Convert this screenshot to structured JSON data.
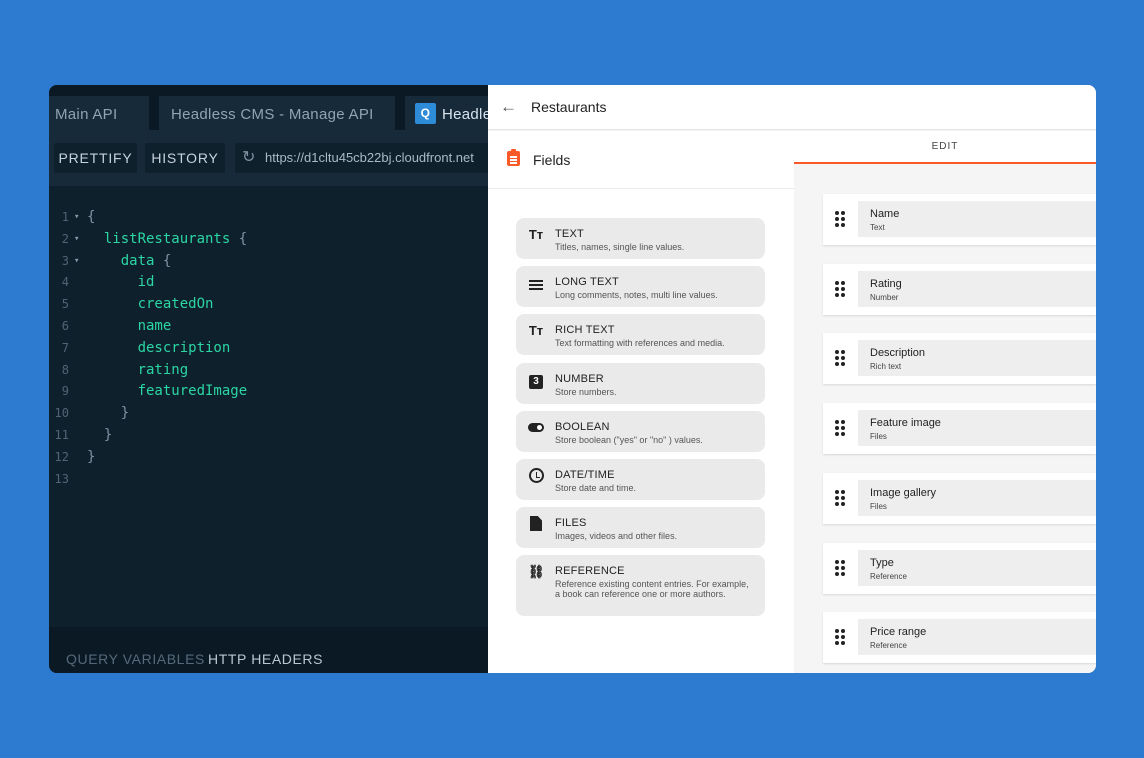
{
  "playground": {
    "tabs": [
      {
        "label": "Main API"
      },
      {
        "label": "Headless CMS - Manage API"
      },
      {
        "badge": "Q",
        "label": "Headless CMS"
      }
    ],
    "toolbar": {
      "prettify": "PRETTIFY",
      "history": "HISTORY",
      "url": "https://d1cltu45cb22bj.cloudfront.net"
    },
    "code": [
      {
        "n": "1",
        "fold": "▾",
        "text": "{",
        "field": ""
      },
      {
        "n": "2",
        "fold": "▾",
        "text": "  ",
        "field": "listRestaurants",
        "after": " {"
      },
      {
        "n": "3",
        "fold": "▾",
        "text": "    ",
        "field": "data",
        "after": " {"
      },
      {
        "n": "4",
        "fold": "",
        "text": "      ",
        "field": "id"
      },
      {
        "n": "5",
        "fold": "",
        "text": "      ",
        "field": "createdOn"
      },
      {
        "n": "6",
        "fold": "",
        "text": "      ",
        "field": "name"
      },
      {
        "n": "7",
        "fold": "",
        "text": "      ",
        "field": "description"
      },
      {
        "n": "8",
        "fold": "",
        "text": "      ",
        "field": "rating"
      },
      {
        "n": "9",
        "fold": "",
        "text": "      ",
        "field": "featuredImage"
      },
      {
        "n": "10",
        "fold": "",
        "text": "    }",
        "field": ""
      },
      {
        "n": "11",
        "fold": "",
        "text": "  }",
        "field": ""
      },
      {
        "n": "12",
        "fold": "",
        "text": "}",
        "field": ""
      },
      {
        "n": "13",
        "fold": "",
        "text": "",
        "field": ""
      }
    ],
    "bottom": {
      "query_variables": "QUERY VARIABLES",
      "http_headers": "HTTP HEADERS"
    }
  },
  "cms": {
    "title": "Restaurants",
    "fields_title": "Fields",
    "edit_tab": "EDIT",
    "field_types": [
      {
        "icon": "text-icon",
        "name": "TEXT",
        "desc": "Titles, names, single line values."
      },
      {
        "icon": "long-text-icon",
        "name": "LONG TEXT",
        "desc": "Long comments, notes, multi line values."
      },
      {
        "icon": "rich-text-icon",
        "name": "RICH TEXT",
        "desc": "Text formatting with references and media."
      },
      {
        "icon": "number-icon",
        "name": "NUMBER",
        "desc": "Store numbers."
      },
      {
        "icon": "boolean-icon",
        "name": "BOOLEAN",
        "desc": "Store boolean (\"yes\" or \"no\" ) values."
      },
      {
        "icon": "clock-icon",
        "name": "DATE/TIME",
        "desc": "Store date and time."
      },
      {
        "icon": "file-icon",
        "name": "FILES",
        "desc": "Images, videos and other files."
      },
      {
        "icon": "link-icon",
        "name": "REFERENCE",
        "desc": "Reference existing content entries. For example, a book can reference one or more authors."
      }
    ],
    "model_fields": [
      {
        "name": "Name",
        "type": "Text"
      },
      {
        "name": "Rating",
        "type": "Number"
      },
      {
        "name": "Description",
        "type": "Rich text"
      },
      {
        "name": "Feature image",
        "type": "Files"
      },
      {
        "name": "Image gallery",
        "type": "Files"
      },
      {
        "name": "Type",
        "type": "Reference"
      },
      {
        "name": "Price range",
        "type": "Reference"
      }
    ],
    "accent_color": "#fa5a28"
  }
}
